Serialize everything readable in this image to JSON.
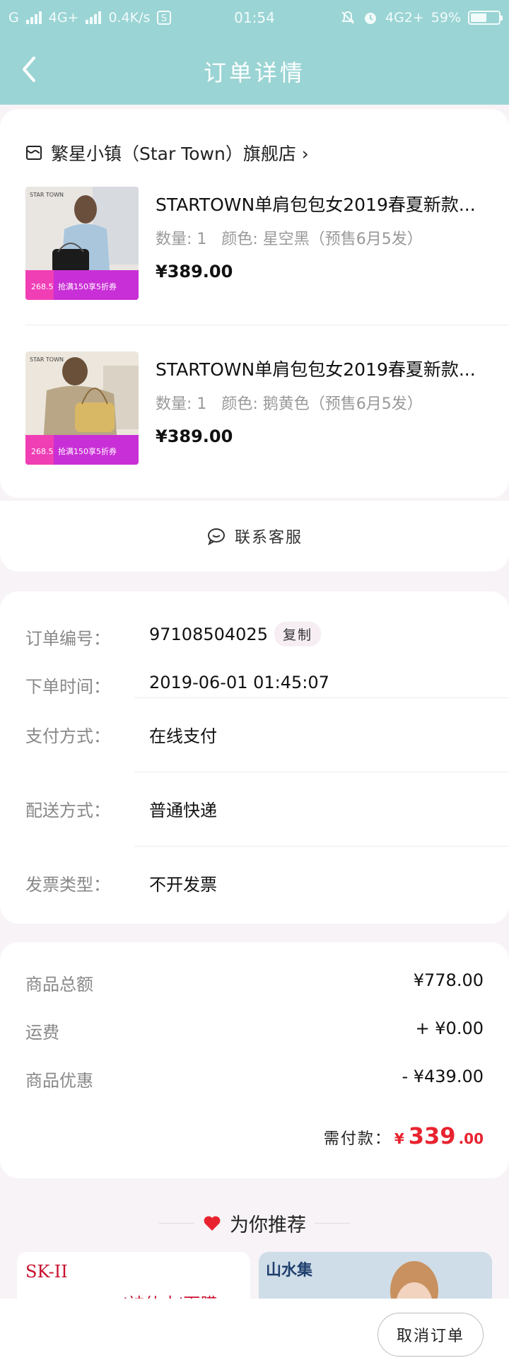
{
  "status_bar": {
    "left_network": "G",
    "network_type": "4G+",
    "speed": "0.4K/s",
    "time": "01:54",
    "right_network": "4G2+",
    "battery": "59%",
    "battery_level": 0.59
  },
  "nav": {
    "title": "订单详情"
  },
  "store": {
    "name": "繁星小镇（Star Town）旗舰店 ›"
  },
  "items": [
    {
      "title": "STARTOWN单肩包包女2019春夏新款...",
      "quantity_label": "数量: 1",
      "color_label": "颜色: 星空黑（预售6月5发）",
      "price": "¥389.00",
      "thumb_brand": "STAR TOWN",
      "thumb_price": "268.5",
      "thumb_promo": "抢满150享5折券",
      "thumb_accent": "#1b1b1b"
    },
    {
      "title": "STARTOWN单肩包包女2019春夏新款...",
      "quantity_label": "数量: 1",
      "color_label": "颜色: 鹅黄色（预售6月5发）",
      "price": "¥389.00",
      "thumb_brand": "STAR TOWN",
      "thumb_price": "268.5",
      "thumb_promo": "抢满150享5折券",
      "thumb_accent": "#d9b865"
    }
  ],
  "service": {
    "label": "联系客服"
  },
  "order_info": {
    "order_no_label": "订单编号：",
    "order_no": "97108504025",
    "copy_label": "复制",
    "time_label": "下单时间：",
    "time": "2019-06-01 01:45:07",
    "pay_label": "支付方式：",
    "pay": "在线支付",
    "delivery_label": "配送方式：",
    "delivery": "普通快递",
    "invoice_label": "发票类型：",
    "invoice": "不开发票"
  },
  "amounts": {
    "goods_total_label": "商品总额",
    "goods_total": "¥778.00",
    "freight_label": "运费",
    "freight": "+ ¥0.00",
    "discount_label": "商品优惠",
    "discount": "- ¥439.00",
    "due_label": "需付款：",
    "due_currency": "¥",
    "due_int": "339",
    "due_dec": ".00"
  },
  "recommend": {
    "title": "为你推荐",
    "left_brand": "SK-II",
    "left_text": "'神仙水'面膜",
    "right_brand": "山水集"
  },
  "bottom": {
    "cancel_label": "取消订单"
  },
  "colors": {
    "header_bg": "#9bd4d4",
    "price_red": "#e8232f",
    "page_bg": "#f7f3f6"
  }
}
